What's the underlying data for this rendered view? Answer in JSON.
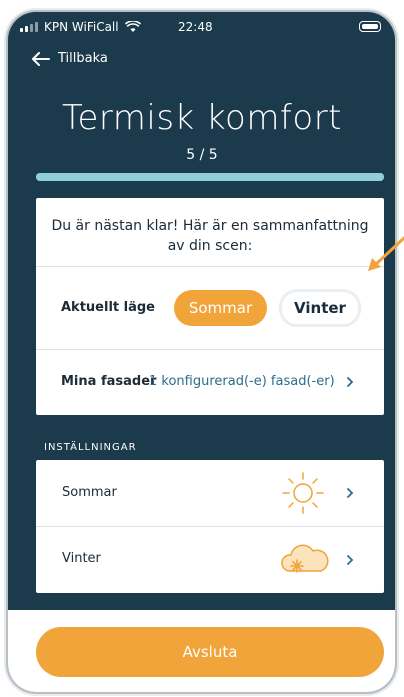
{
  "statusbar": {
    "carrier": "KPN WiFiCall",
    "time": "22:48"
  },
  "nav": {
    "back_label": "Tillbaka"
  },
  "header": {
    "title": "Termisk komfort",
    "step": "5 / 5",
    "progress_fraction": 1.0
  },
  "summary": {
    "title": "Du är nästan klar! Här är en sammanfattning av din scen:",
    "mode_label": "Aktuellt läge",
    "mode_options": [
      "Sommar",
      "Vinter"
    ],
    "mode_selected": "Sommar",
    "facades_label": "Mina fasader",
    "facades_value": "1 konfigurerad(-e) fasad(-er)"
  },
  "settings": {
    "section_title": "INSTÄLLNINGAR",
    "items": [
      {
        "label": "Sommar",
        "icon": "sun-icon"
      },
      {
        "label": "Vinter",
        "icon": "cloud-snow-icon"
      }
    ]
  },
  "footer": {
    "finish_label": "Avsluta"
  },
  "colors": {
    "background": "#1b3a4b",
    "accent": "#f0a43a",
    "progress": "#8fd0d6",
    "link": "#2c6c8d"
  }
}
